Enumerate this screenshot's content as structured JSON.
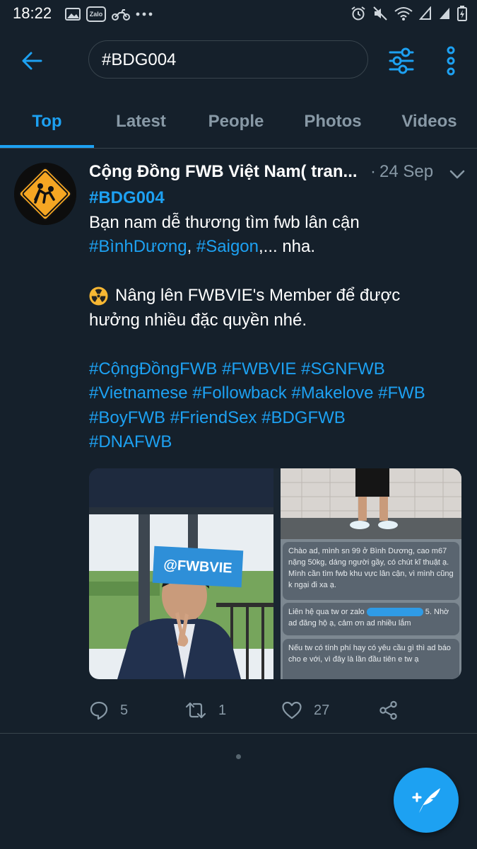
{
  "status_bar": {
    "time": "18:22",
    "left_icons": [
      "image-icon",
      "zalo-icon",
      "motorbike-icon",
      "more-dots-icon"
    ],
    "zalo_label": "Zalo",
    "right_icons": [
      "alarm-icon",
      "mute-icon",
      "wifi-icon",
      "signal-icon",
      "signal-icon",
      "battery-icon"
    ]
  },
  "header": {
    "search_value": "#BDG004",
    "back_icon": "arrow-left-icon",
    "filter_icon": "sliders-icon",
    "more_icon": "vertical-dots-icon"
  },
  "tabs": [
    {
      "label": "Top",
      "active": true
    },
    {
      "label": "Latest",
      "active": false
    },
    {
      "label": "People",
      "active": false
    },
    {
      "label": "Photos",
      "active": false
    },
    {
      "label": "Videos",
      "active": false
    }
  ],
  "tweet": {
    "author": "Cộng Đồng FWB Việt Nam( tran...",
    "separator": "·",
    "date": "24 Sep",
    "hashtag_head": "#BDG004",
    "line1": "Bạn nam dễ thương tìm fwb lân cận",
    "line2_tag1": "#BìnhDương",
    "line2_comma": ", ",
    "line2_tag2": "#Saigon",
    "line2_rest": ",... nha.",
    "para2_line1": "Nâng lên FWBVIE's Member để được",
    "para2_line2": "hưởng nhiều đặc quyền nhé.",
    "hashtag_lines": [
      "#CộngĐồngFWB #FWBVIE #SGNFWB",
      "#Vietnamese #Followback #Makelove #FWB",
      "#BoyFWB #FriendSex #BDGFWB",
      "#DNAFWB"
    ],
    "media": {
      "photo_tag": "@FWBVIE",
      "chat_msg_1": "Chào ad, mình sn 99 ở Bình Dương, cao m67 nặng 50kg, dáng người gầy, có chút kĩ thuật ạ. Mình cần tìm fwb khu vực lân cận, vì mình cũng k ngại đi xa ạ.",
      "chat_msg_2_a": "Liên hệ qua tw or zalo",
      "chat_msg_2_b": "5. Nhờ ad đăng hộ ạ, cảm ơn ad nhiều lắm",
      "chat_msg_3": "Nếu tw có tính phí hay có yêu cầu gì thì ad báo cho e với, vì đây là lần đầu tiên e tw ạ"
    },
    "actions": {
      "replies": "5",
      "retweets": "1",
      "likes": "27"
    }
  },
  "fab": {
    "icon": "compose-tweet-icon"
  },
  "colors": {
    "background": "#15202b",
    "accent": "#1da1f2",
    "muted": "#8899a6",
    "divider": "#38444d"
  }
}
